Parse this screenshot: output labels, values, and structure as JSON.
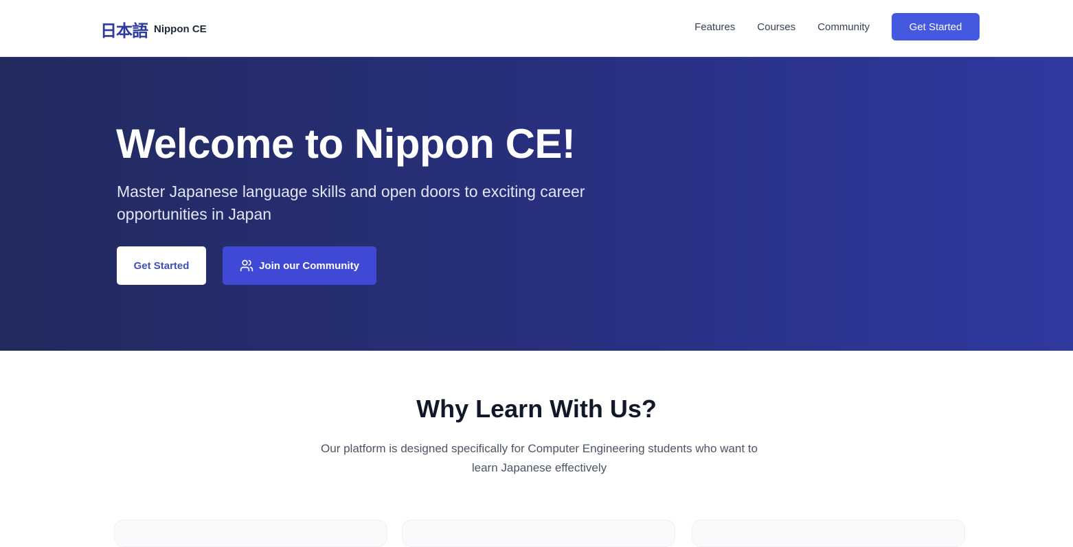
{
  "header": {
    "logo_jp": "日本語",
    "logo_text": "Nippon CE",
    "nav": [
      "Features",
      "Courses",
      "Community"
    ],
    "cta_label": "Get Started"
  },
  "hero": {
    "title": "Welcome to Nippon CE!",
    "subtitle": "Master Japanese language skills and open doors to exciting career opportunities in Japan",
    "primary_button": "Get Started",
    "secondary_button": "Join our Community",
    "secondary_button_icon": "users-icon"
  },
  "features": {
    "title": "Why Learn With Us?",
    "description": "Our platform is designed specifically for Computer Engineering students who want to learn Japanese effectively"
  },
  "colors": {
    "brand": "#2e3a9f",
    "accent": "#4459e0",
    "hero_start": "#222a5e",
    "hero_end": "#3039a0"
  }
}
